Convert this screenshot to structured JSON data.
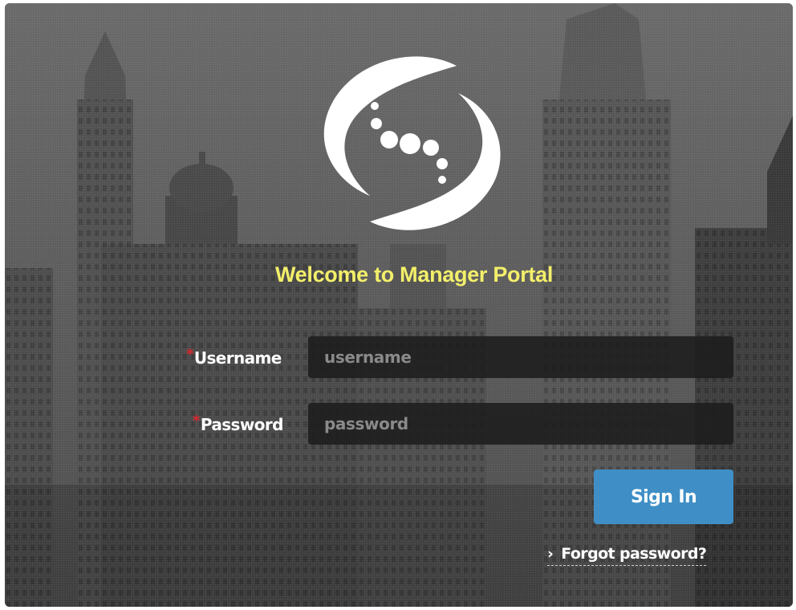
{
  "page": {
    "title": "Welcome to Manager Portal"
  },
  "form": {
    "username": {
      "label": "Username",
      "required_mark": "*",
      "placeholder": "username",
      "value": ""
    },
    "password": {
      "label": "Password",
      "required_mark": "*",
      "placeholder": "password",
      "value": ""
    },
    "sign_in_label": "Sign In",
    "forgot_label": "Forgot password?",
    "forgot_chevron": "›"
  },
  "icons": {
    "logo": "swirl-logo-icon",
    "forgot": "chevron-right-icon"
  },
  "colors": {
    "title": "#f3ef6a",
    "required": "#d9262b",
    "button": "#3f8fc6",
    "field_bg": "#1c1c1c"
  }
}
